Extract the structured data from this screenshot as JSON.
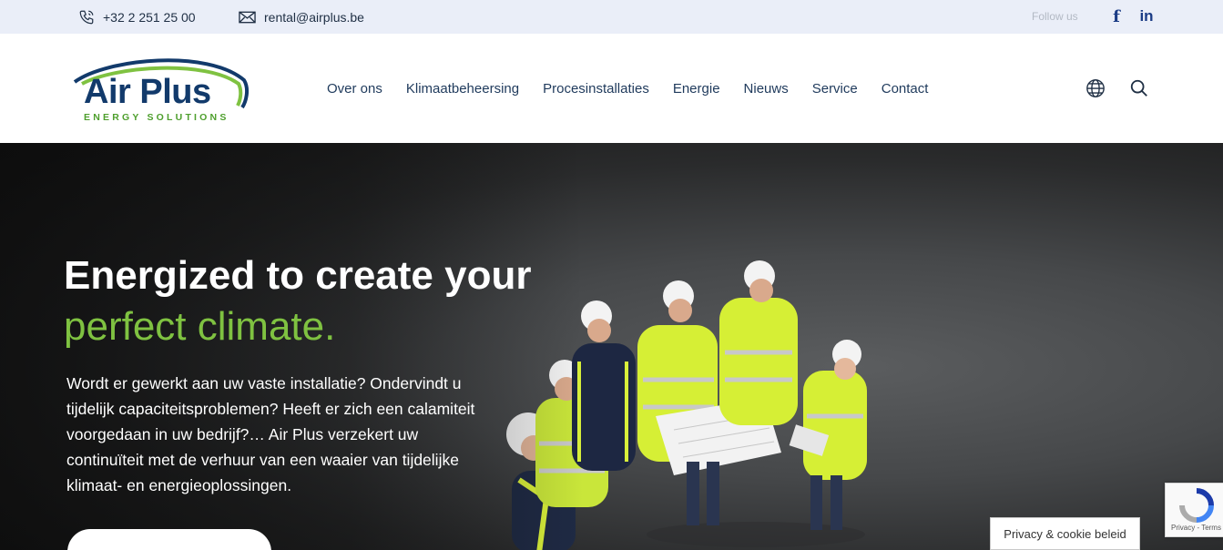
{
  "topbar": {
    "phone": "+32 2 251 25 00",
    "email": "rental@airplus.be",
    "follow_label": "Follow us",
    "social": [
      {
        "name": "facebook-icon",
        "glyph": "f"
      },
      {
        "name": "linkedin-icon",
        "glyph": "in"
      }
    ]
  },
  "header": {
    "logo": {
      "main": "Air Plus",
      "sub": "ENERGY SOLUTIONS"
    },
    "nav": [
      "Over ons",
      "Klimaatbeheersing",
      "Procesinstallaties",
      "Energie",
      "Nieuws",
      "Service",
      "Contact"
    ],
    "icons": {
      "language": "globe-icon",
      "search": "search-icon"
    }
  },
  "hero": {
    "title_line1": "Energized to create your",
    "title_line2": "perfect climate.",
    "body": "Wordt er gewerkt aan uw vaste installatie? Ondervindt u tijdelijk capaciteitsproblemen? Heeft er zich een calamiteit voorgedaan in uw bedrijf?… Air Plus verzekert uw continuïteit met de verhuur van een waaier van tijdelijke klimaat- en energieoplossingen.",
    "cta_label": ""
  },
  "recaptcha": {
    "terms": "Privacy - Terms"
  },
  "privacy_label": "Privacy & cookie beleid",
  "colors": {
    "navy": "#123a6b",
    "green": "#7fc241",
    "topbar_bg": "#eaeef8",
    "social": "#1b3c86"
  }
}
